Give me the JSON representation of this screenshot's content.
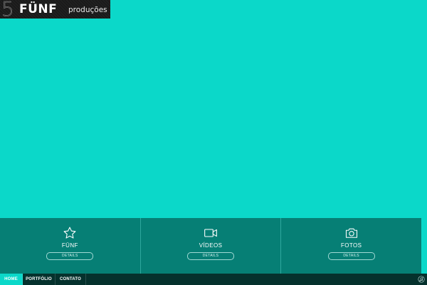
{
  "logo": {
    "mark": "5",
    "name": "FÜNF",
    "subtitle": "produções"
  },
  "features": [
    {
      "icon": "star-icon",
      "title": "FÜNF",
      "button": "DETAILS"
    },
    {
      "icon": "video-camera-icon",
      "title": "VÍDEOS",
      "button": "DETAILS"
    },
    {
      "icon": "photo-camera-icon",
      "title": "FOTOS",
      "button": "DETAILS"
    }
  ],
  "nav": {
    "items": [
      "HOME",
      "PORTFÓLIO",
      "CONTATO"
    ],
    "active": "HOME",
    "corner_icon": "music-icon"
  },
  "colors": {
    "background": "#0bd8c9",
    "panel": "#067f75",
    "bar": "#05312d",
    "active_tab": "#0bd8c9"
  }
}
